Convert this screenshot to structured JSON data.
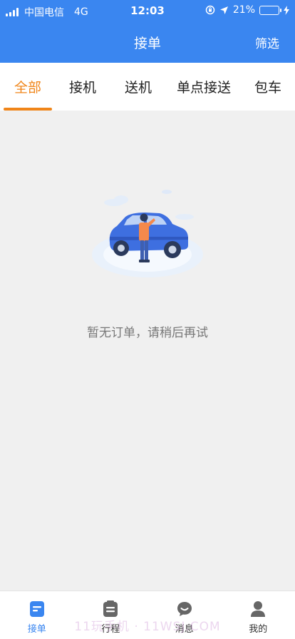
{
  "status_bar": {
    "carrier": "中国电信",
    "network": "4G",
    "time": "12:03",
    "battery_percent": "21%",
    "battery_level": 0.21
  },
  "nav": {
    "title": "接单",
    "filter_label": "筛选"
  },
  "tabs": [
    {
      "label": "全部"
    },
    {
      "label": "接机"
    },
    {
      "label": "送机"
    },
    {
      "label": "单点接送"
    },
    {
      "label": "包车"
    }
  ],
  "empty_state": {
    "message": "暂无订单，请稍后再试",
    "icon": "car-with-person-illustration"
  },
  "tabbar": {
    "items": [
      {
        "label": "接单",
        "icon": "order-icon"
      },
      {
        "label": "行程",
        "icon": "trip-icon"
      },
      {
        "label": "消息",
        "icon": "message-icon"
      },
      {
        "label": "我的",
        "icon": "profile-icon"
      }
    ]
  },
  "watermark": "11玩手机 · 11WSJ.COM",
  "colors": {
    "primary": "#3a86f0",
    "accent": "#f08519",
    "background": "#f0f0f0"
  }
}
